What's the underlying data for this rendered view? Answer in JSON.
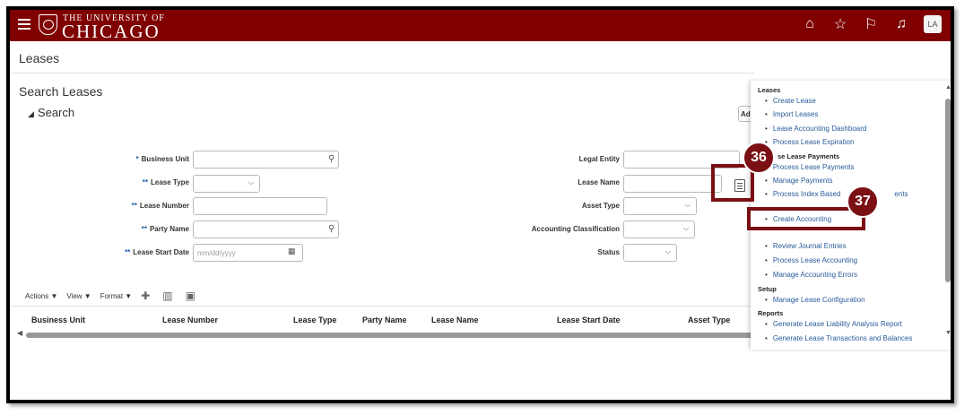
{
  "header": {
    "logo_top": "THE UNIVERSITY OF",
    "logo_main": "CHICAGO",
    "avatar": "LA",
    "icons": [
      "home-icon",
      "star-icon",
      "flag-icon",
      "bell-icon"
    ],
    "brand_color": "#800000"
  },
  "page": {
    "title": "Leases",
    "search_title": "Search Leases",
    "search_sub": "Search",
    "advanced_label": "Ad"
  },
  "form": {
    "business_unit": {
      "label": "Business Unit",
      "req": "*"
    },
    "lease_type": {
      "label": "Lease Type",
      "req": "**"
    },
    "lease_number": {
      "label": "Lease Number",
      "req": "**"
    },
    "party_name": {
      "label": "Party Name",
      "req": "**"
    },
    "lease_start_date": {
      "label": "Lease Start Date",
      "req": "**",
      "placeholder": "mm/dd/yyyy"
    },
    "legal_entity": {
      "label": "Legal Entity"
    },
    "lease_name": {
      "label": "Lease Name"
    },
    "asset_type": {
      "label": "Asset Type"
    },
    "accounting_classification": {
      "label": "Accounting Classification"
    },
    "status": {
      "label": "Status"
    }
  },
  "toolbar": {
    "actions": "Actions ▼",
    "view": "View ▼",
    "format": "Format ▼"
  },
  "table": {
    "columns": [
      "Business Unit",
      "Lease Number",
      "Lease Type",
      "Party Name",
      "Lease Name",
      "Lease Start Date",
      "Asset Type"
    ]
  },
  "panel": {
    "sections": {
      "leases": "Leases",
      "lease_payments": "se Lease Payments",
      "setup": "Setup",
      "reports": "Reports"
    },
    "links": {
      "create_lease": "Create Lease",
      "import_leases": "Import Leases",
      "lease_accounting_dashboard": "Lease Accounting Dashboard",
      "process_lease_expiration": "Process Lease Expiration",
      "process_lease_payments": "Process Lease Payments",
      "manage_payments": "Manage Payments",
      "process_index_based": "Process Index Based",
      "process_index_based_tail": "ents",
      "create_accounting": "Create Accounting",
      "review_journal_entries": "Review Journal Entries",
      "process_lease_accounting": "Process Lease Accounting",
      "manage_accounting_errors": "Manage Accounting Errors",
      "manage_lease_configuration": "Manage Lease Configuration",
      "generate_liability_report": "Generate Lease Liability Analysis Report",
      "generate_transactions": "Generate Lease Transactions and Balances"
    }
  },
  "callouts": {
    "c36": "36",
    "c37": "37",
    "color": "#7a0f14"
  }
}
